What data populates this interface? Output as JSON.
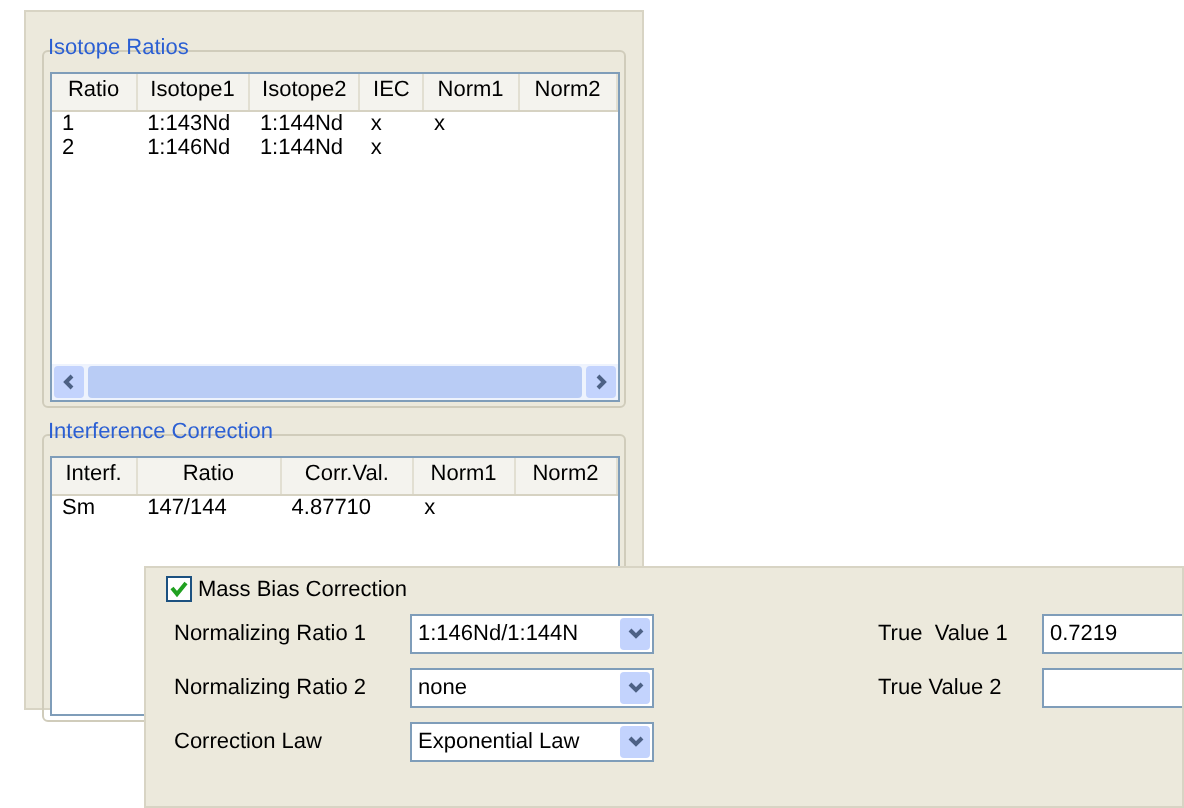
{
  "isotope_ratios": {
    "title": "Isotope Ratios",
    "columns": [
      "Ratio",
      "Isotope1",
      "Isotope2",
      "IEC",
      "Norm1",
      "Norm2"
    ],
    "rows": [
      [
        "1",
        "1:143Nd",
        "1:144Nd",
        "x",
        "x",
        null
      ],
      [
        "2",
        "1:146Nd",
        "1:144Nd",
        "x",
        null,
        null
      ]
    ]
  },
  "interference_correction": {
    "title": "Interference Correction",
    "columns": [
      "Interf.",
      "Ratio",
      "Corr.Val.",
      "Norm1",
      "Norm2"
    ],
    "rows": [
      [
        "Sm",
        "147/144",
        "4.87710",
        "x",
        null
      ]
    ]
  },
  "mass_bias": {
    "label": "Mass Bias Correction",
    "checked": true,
    "dropdowns": [
      {
        "label": "Normalizing Ratio 1",
        "value": "1:146Nd/1:144N"
      },
      {
        "label": "Normalizing Ratio 2",
        "value": "none"
      },
      {
        "label": "Correction Law",
        "value": "Exponential Law"
      }
    ],
    "fields": [
      {
        "label": "True  Value 1",
        "value": "0.7219"
      },
      {
        "label": "True Value 2"
      }
    ]
  }
}
